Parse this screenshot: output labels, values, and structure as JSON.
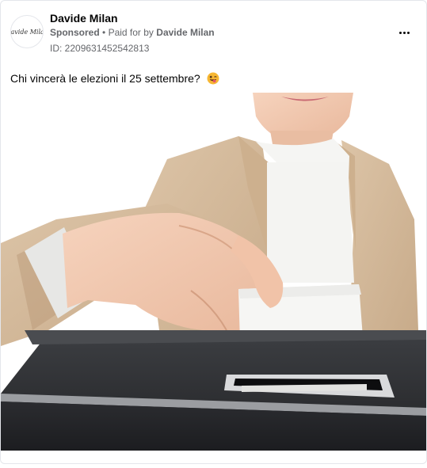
{
  "post": {
    "author": "Davide Milan",
    "avatar_text": "Davide Milan",
    "sponsored_label": "Sponsored",
    "separator": "•",
    "paid_for_label": "Paid for by",
    "paid_for_name": "Davide Milan",
    "ad_id": "ID: 2209631452542813",
    "caption": "Chi vincerà le elezioni il 25 settembre?",
    "caption_emoji": "winking-face-with-tongue-icon",
    "more_icon": "more-options-icon",
    "image": "person-placing-ballot-in-box"
  }
}
